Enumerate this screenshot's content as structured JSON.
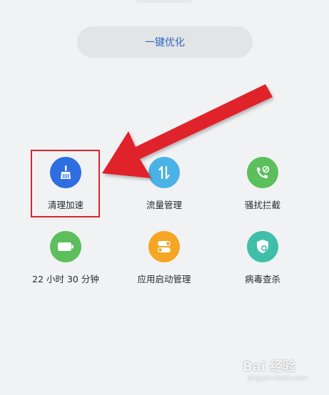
{
  "optimize_label": "一键优化",
  "colors": {
    "accent_blue": "#2c67c8",
    "clean_icon_bg": "#2f6ee0",
    "traffic_icon_bg": "#4ab2e6",
    "block_icon_bg": "#5cbf5c",
    "battery_icon_bg": "#5cbf5c",
    "launch_icon_bg": "#f5a623",
    "virus_icon_bg": "#3fbfa8",
    "highlight": "#d8262e"
  },
  "tools": [
    {
      "label": "清理加速",
      "icon": "broom-icon"
    },
    {
      "label": "流量管理",
      "icon": "data-traffic-icon"
    },
    {
      "label": "骚扰拦截",
      "icon": "call-block-icon"
    },
    {
      "label": "22 小时 30 分钟",
      "icon": "battery-icon"
    },
    {
      "label": "应用启动管理",
      "icon": "toggle-icon"
    },
    {
      "label": "病毒查杀",
      "icon": "shield-scan-icon"
    }
  ],
  "watermark": {
    "text": "Bai 经验",
    "sub": "jingyan.baidu.com"
  }
}
